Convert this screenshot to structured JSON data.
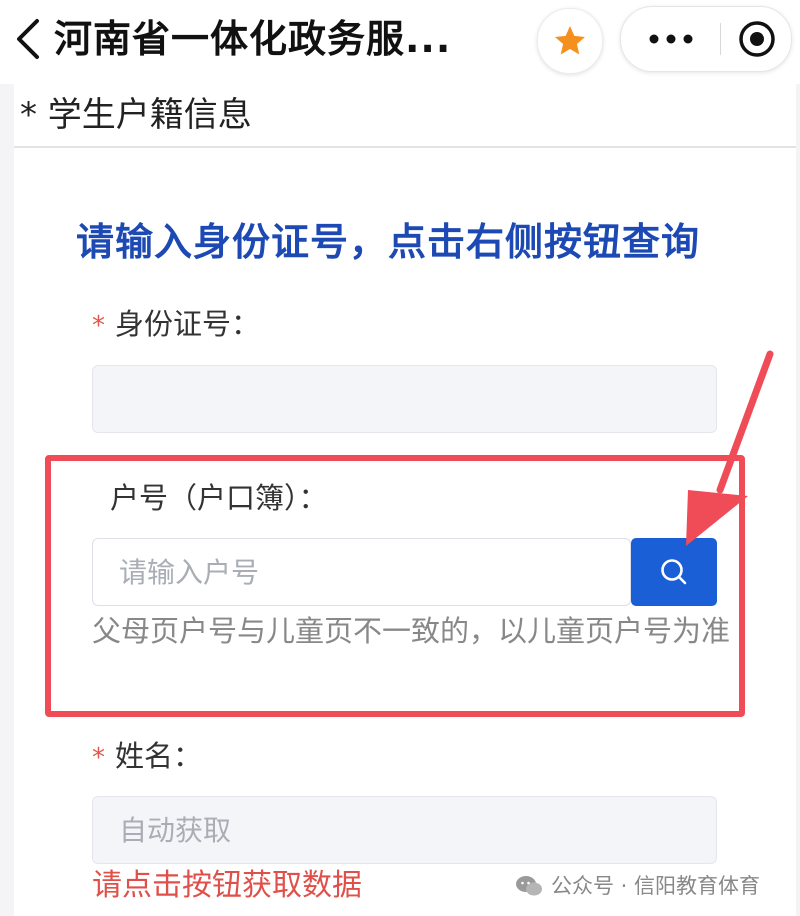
{
  "navbar": {
    "title": "河南省一体化政务服...",
    "back_icon": "chevron-left-icon",
    "star_icon": "star-icon",
    "more_icon": "more-dots-icon",
    "close_icon": "target-close-icon",
    "star_color": "#f5901f"
  },
  "section": {
    "title": "* 学生户籍信息"
  },
  "form": {
    "instruction": "请输入身份证号，点击右侧按钮查询",
    "id_field": {
      "required": "*",
      "label": "身份证号：",
      "value": ""
    },
    "household_field": {
      "label": "户号（户口簿）：",
      "placeholder": "请输入户号",
      "search_icon": "search-icon",
      "hint": "父母页户号与儿童页不一致的，以儿童页户号为准"
    },
    "name_field": {
      "required": "*",
      "label": "姓名：",
      "placeholder": "自动获取",
      "error": "请点击按钮获取数据"
    }
  },
  "colors": {
    "accent": "#1a5fd6",
    "instruction": "#1c49b3",
    "required": "#e2564a",
    "highlight": "#ef4c58"
  },
  "watermark": {
    "text": "公众号 · 信阳教育体育"
  }
}
